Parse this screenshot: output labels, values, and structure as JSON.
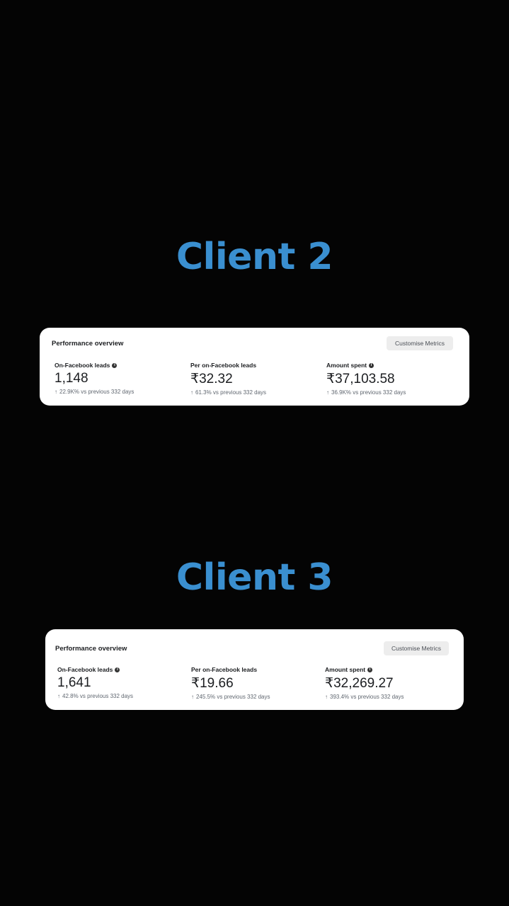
{
  "clients": [
    {
      "title": "Client 2",
      "card": {
        "title": "Performance overview",
        "customise_label": "Customise Metrics",
        "metrics": [
          {
            "label": "On-Facebook leads",
            "has_info_icon": true,
            "value": "1,148",
            "change": "22.9K% vs previous 332 days"
          },
          {
            "label": "Per on-Facebook leads",
            "has_info_icon": false,
            "value": "₹32.32",
            "change": "61.3% vs previous 332 days"
          },
          {
            "label": "Amount spent",
            "has_info_icon": true,
            "value": "₹37,103.58",
            "change": "36.9K% vs previous 332 days"
          }
        ]
      }
    },
    {
      "title": "Client 3",
      "card": {
        "title": "Performance overview",
        "customise_label": "Customise Metrics",
        "metrics": [
          {
            "label": "On-Facebook leads",
            "has_info_icon": true,
            "value": "1,641",
            "change": "42.8% vs previous 332 days"
          },
          {
            "label": "Per on-Facebook leads",
            "has_info_icon": false,
            "value": "₹19.66",
            "change": "245.5% vs previous 332 days"
          },
          {
            "label": "Amount spent",
            "has_info_icon": true,
            "value": "₹32,269.27",
            "change": "393.4% vs previous 332 days"
          }
        ]
      }
    }
  ],
  "icons": {
    "info": "info-icon",
    "trend": "arrow-up-icon"
  },
  "colors": {
    "background": "#040404",
    "title": "#3a8fd0",
    "card": "#ffffff"
  }
}
